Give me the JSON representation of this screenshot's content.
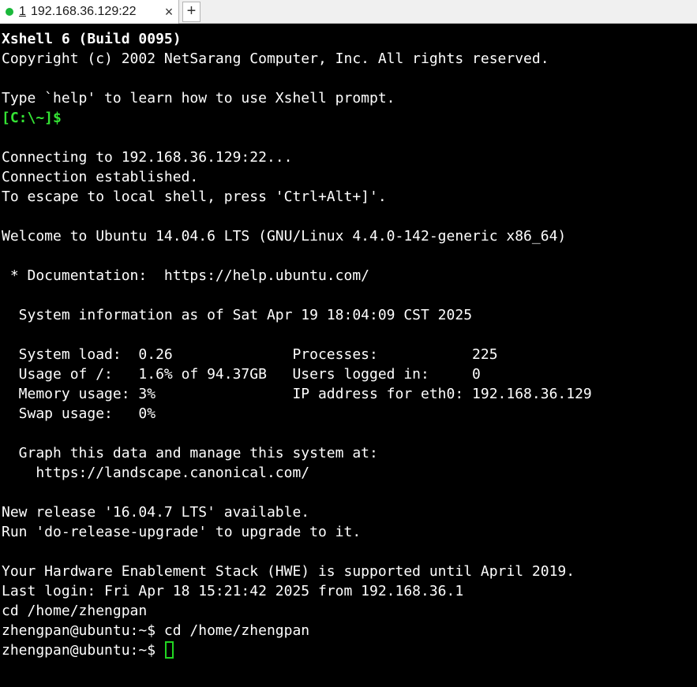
{
  "tab": {
    "index": "1",
    "title": "192.168.36.129:22",
    "close_label": "×",
    "add_label": "+"
  },
  "colors": {
    "terminal_bg": "#000000",
    "terminal_fg": "#ffffff",
    "prompt_green": "#34e334",
    "cursor_green": "#21d521",
    "status_dot": "#1ab83a"
  },
  "terminal": {
    "lines": [
      "Xshell 6 (Build 0095)",
      "Copyright (c) 2002 NetSarang Computer, Inc. All rights reserved.",
      "",
      "Type `help' to learn how to use Xshell prompt.",
      "[C:\\~]$",
      "",
      "Connecting to 192.168.36.129:22...",
      "Connection established.",
      "To escape to local shell, press 'Ctrl+Alt+]'.",
      "",
      "Welcome to Ubuntu 14.04.6 LTS (GNU/Linux 4.4.0-142-generic x86_64)",
      "",
      " * Documentation:  https://help.ubuntu.com/",
      "",
      "  System information as of Sat Apr 19 18:04:09 CST 2025",
      "",
      "  System load:  0.26              Processes:           225",
      "  Usage of /:   1.6% of 94.37GB   Users logged in:     0",
      "  Memory usage: 3%                IP address for eth0: 192.168.36.129",
      "  Swap usage:   0%",
      "",
      "  Graph this data and manage this system at:",
      "    https://landscape.canonical.com/",
      "",
      "New release '16.04.7 LTS' available.",
      "Run 'do-release-upgrade' to upgrade to it.",
      "",
      "Your Hardware Enablement Stack (HWE) is supported until April 2019.",
      "Last login: Fri Apr 18 15:21:42 2025 from 192.168.36.1",
      "cd /home/zhengpan",
      "zhengpan@ubuntu:~$ cd /home/zhengpan"
    ],
    "current_prompt": "zhengpan@ubuntu:~$ "
  }
}
